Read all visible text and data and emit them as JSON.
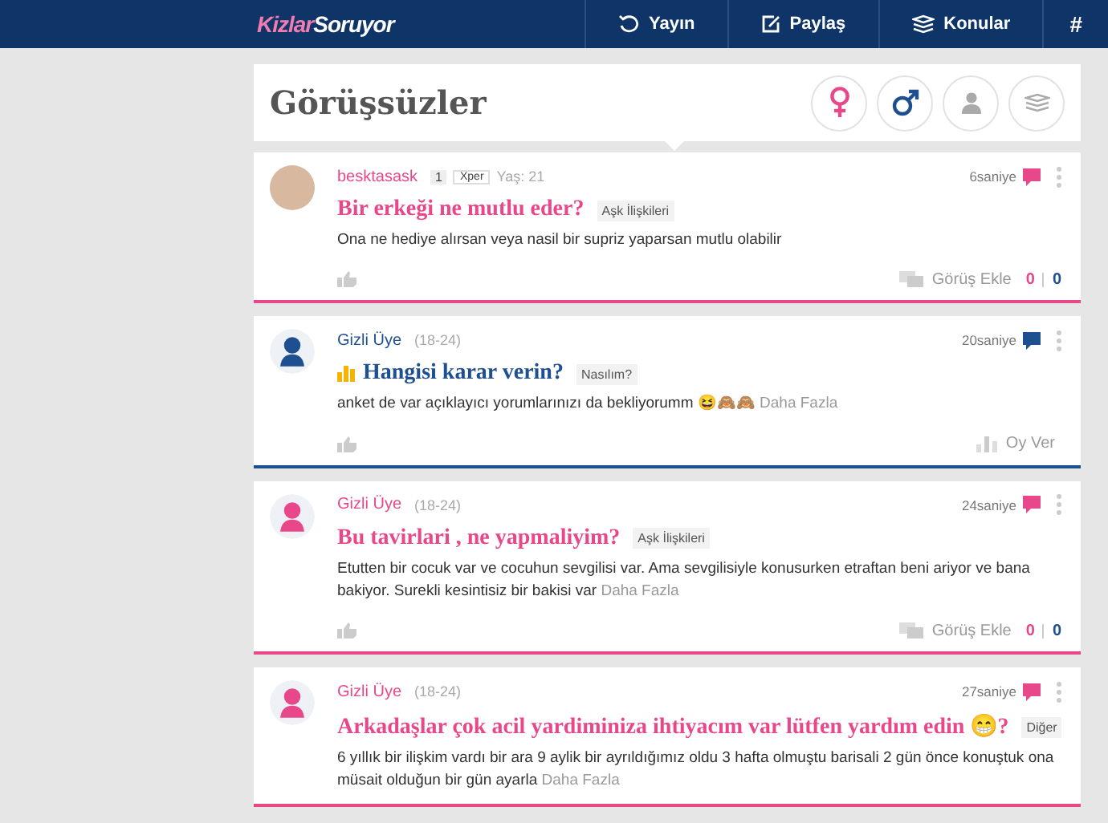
{
  "topbar": {
    "logo": {
      "part_1": "Kizlar",
      "part_2": "Soruyor"
    },
    "nav": [
      {
        "label": "Yayın"
      },
      {
        "label": "Paylaş"
      },
      {
        "label": "Konular"
      },
      {
        "label": "#"
      }
    ]
  },
  "header": {
    "title": "Görüşsüzler",
    "filters": [
      {
        "kind": "female"
      },
      {
        "kind": "male"
      },
      {
        "kind": "person"
      },
      {
        "kind": "stack"
      }
    ]
  },
  "cards": [
    {
      "color": "#e8488a",
      "kind": "photo",
      "author": "besktasask",
      "level": "1",
      "level_tag": "Xper",
      "age": "Yaş: 21",
      "time": "6saniye",
      "poll": false,
      "title": "Bir erkeği ne mutlu eder?",
      "topic": "Aşk İlişkileri",
      "body": "Ona ne hediye alırsan veya nasil bir supriz yaparsan mutlu olabilir",
      "footer": {
        "kind": "opinion",
        "label": "Görüş Ekle",
        "count_1": "0",
        "count_2": "0"
      }
    },
    {
      "color": "#1d4f91",
      "kind": "silhouette",
      "author": "Gizli Üye",
      "age": "(18-24)",
      "time": "20saniye",
      "poll": true,
      "title": "Hangisi karar verin?",
      "topic": "Nasılım?",
      "body": "anket de var açıklayıcı yorumlarınızı da bekliyorumm 😆🙈🙈",
      "more": "Daha Fazla",
      "footer": {
        "kind": "vote",
        "label": "Oy Ver"
      }
    },
    {
      "color": "#e8488a",
      "kind": "silhouette",
      "author": "Gizli Üye",
      "age": "(18-24)",
      "time": "24saniye",
      "poll": false,
      "title": "Bu tavirlari , ne yapmaliyim?",
      "topic": "Aşk İlişkileri",
      "body": "Etutten bir cocuk var ve cocuhun sevgilisi var. Ama sevgilisiyle konusurken etraftan beni ariyor ve bana bakiyor. Surekli kesintisiz bir bakisi var",
      "more": "Daha Fazla",
      "footer": {
        "kind": "opinion",
        "label": "Görüş Ekle",
        "count_1": "0",
        "count_2": "0"
      }
    },
    {
      "color": "#e8488a",
      "kind": "silhouette",
      "author": "Gizli Üye",
      "age": "(18-24)",
      "time": "27saniye",
      "poll": false,
      "title": "Arkadaşlar çok acil yardiminiza ihtiyacım var lütfen yardım edin 😁?",
      "topic": "Diğer",
      "body": "6 yıllık bir ilişkim vardı bir ara 9 aylik bir ayrıldığımız oldu 3 hafta olmuştu barisali 2 gün önce konuştuk ona müsait olduğun bir gün ayarla",
      "more": "Daha Fazla"
    }
  ]
}
